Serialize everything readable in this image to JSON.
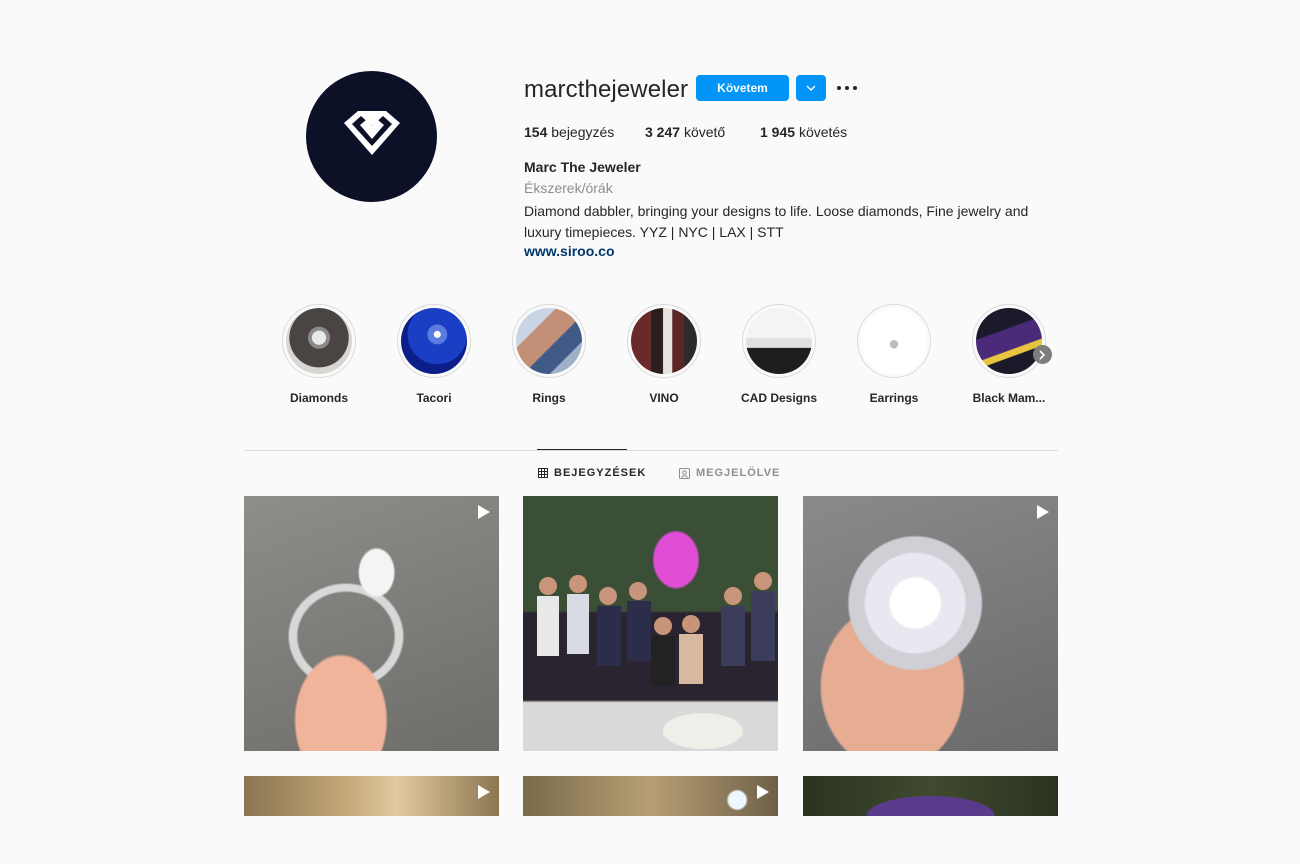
{
  "profile": {
    "username": "marcthejeweler",
    "follow_label": "Követem",
    "stats": {
      "posts_count": "154",
      "posts_label": "bejegyzés",
      "followers_count": "3 247",
      "followers_label": "követő",
      "following_count": "1 945",
      "following_label": "követés"
    },
    "full_name": "Marc The Jeweler",
    "category": "Ékszerek/órák",
    "bio": "Diamond dabbler, bringing your designs to life. Loose diamonds, Fine jewelry and luxury timepieces. YYZ | NYC | LAX | STT",
    "website": "www.siroo.co"
  },
  "highlights": [
    {
      "label": "Diamonds"
    },
    {
      "label": "Tacori"
    },
    {
      "label": "Rings"
    },
    {
      "label": "VINO"
    },
    {
      "label": "CAD Designs"
    },
    {
      "label": "Earrings"
    },
    {
      "label": "Black Mam..."
    }
  ],
  "tabs": {
    "posts": "BEJEGYZÉSEK",
    "tagged": "MEGJELÖLVE"
  },
  "posts": [
    {
      "type": "video"
    },
    {
      "type": "video"
    },
    {
      "type": "video"
    },
    {
      "type": "video"
    },
    {
      "type": "video"
    },
    {
      "type": "image"
    }
  ],
  "colors": {
    "accent": "#0095f6",
    "link": "#00376b",
    "avatar_bg": "#0c1128"
  }
}
